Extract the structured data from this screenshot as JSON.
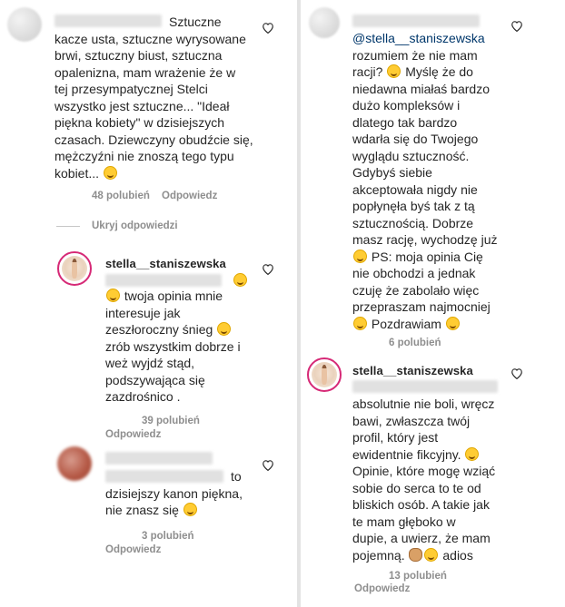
{
  "left": {
    "comment1": {
      "text": "Sztuczne kacze usta, sztuczne wyrysowane brwi, sztuczny biust, sztuczna opalenizna, mam wrażenie że w tej przesympatycznej Stelci wszystko jest sztuczne... \"Ideał piękna kobiety\" w dzisiejszych czasach. Dziewczyny obudźcie się, mężczyźni nie znoszą tego typu kobiet...",
      "lines": [
        "Sztuczne",
        "kacze usta, sztuczne wyrysowane",
        "brwi, sztuczny biust, sztuczna",
        "opalenizna, mam wrażenie że w",
        "tej przesympatycznej Stelci",
        "wszystko jest sztuczne... \"Ideał",
        "piękna kobiety\" w dzisiejszych",
        "czasach. Dziewczyny obudźcie się,",
        "mężczyźni nie znoszą tego typu",
        "kobiet..."
      ],
      "likes": "48 polubień",
      "reply": "Odpowiedz"
    },
    "hide_replies": "Ukryj odpowiedzi",
    "reply1": {
      "username": "stella__staniszewska",
      "lines": [
        "twoja opinia mnie",
        "interesuje jak",
        "zeszłoroczny śnieg",
        "zrób wszystkim dobrze i",
        "weż wyjdź stąd,",
        "podszywająca się",
        "zazdrośnico ."
      ],
      "likes": "39 polubień",
      "reply": "Odpowiedz"
    },
    "reply2": {
      "lines": [
        "to",
        "dzisiejszy kanon piękna,",
        "nie znasz się"
      ],
      "likes": "3 polubień",
      "reply": "Odpowiedz"
    }
  },
  "right": {
    "comment1": {
      "mention": "@stella__staniszewska",
      "lines": [
        "rozumiem że nie mam",
        "racji?",
        "Myślę że do",
        "niedawna miałaś bardzo",
        "dużo kompleksów i",
        "dlatego tak bardzo",
        "wdarła się do Twojego",
        "wyglądu sztuczność.",
        "Gdybyś siebie",
        "akceptowała nigdy nie",
        "popłynęła byś tak z tą",
        "sztucznością. Dobrze",
        "masz rację, wychodzę już",
        "PS: moja opinia Cię",
        "nie obchodzi a jednak",
        "czuję że zabolało więc",
        "przepraszam najmocniej",
        "Pozdrawiam"
      ],
      "likes": "6 polubień"
    },
    "reply1": {
      "username": "stella__staniszewska",
      "lines": [
        "absolutnie nie boli, wręcz",
        "bawi, zwłaszcza twój",
        "profil, który jest",
        "ewidentnie fikcyjny.",
        "Opinie, które mogę wziąć",
        "sobie do serca to te od",
        "bliskich osób. A takie jak",
        "te mam głęboko w",
        "dupie, a uwierz, że mam",
        "pojemną.",
        "adios"
      ],
      "likes": "13 polubień",
      "reply": "Odpowiedz"
    }
  }
}
